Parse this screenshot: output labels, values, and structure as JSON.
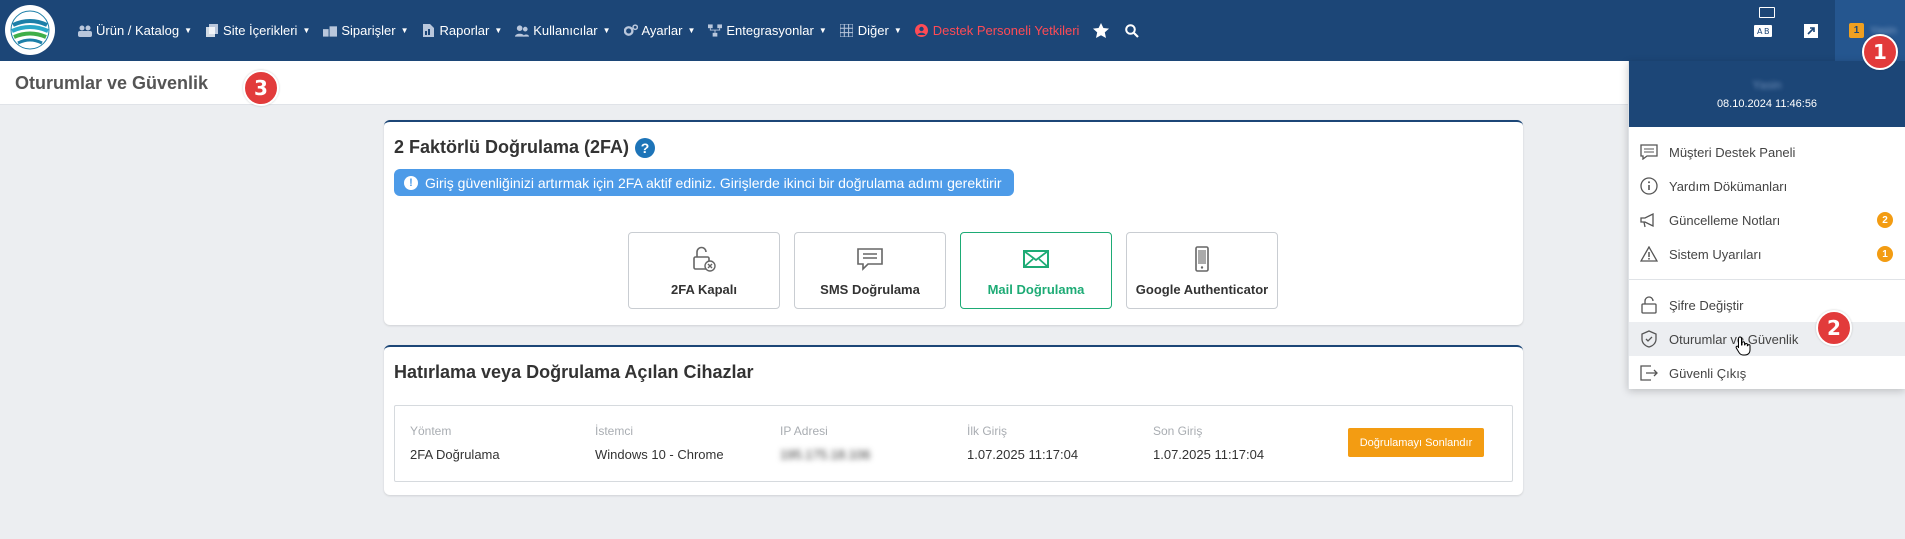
{
  "nav": {
    "items": [
      {
        "label": "Ürün / Katalog",
        "icon": "users-icon"
      },
      {
        "label": "Site İçerikleri",
        "icon": "files-icon"
      },
      {
        "label": "Siparişler",
        "icon": "cart-icon"
      },
      {
        "label": "Raporlar",
        "icon": "report-icon"
      },
      {
        "label": "Kullanıcılar",
        "icon": "user-group-icon"
      },
      {
        "label": "Ayarlar",
        "icon": "gears-icon"
      },
      {
        "label": "Entegrasyonlar",
        "icon": "sitemap-icon"
      },
      {
        "label": "Diğer",
        "icon": "grid-icon"
      }
    ],
    "support": "Destek Personeli Yetkileri",
    "user_badge": "1",
    "user_name": "Yasin"
  },
  "page": {
    "title": "Oturumlar ve Güvenlik"
  },
  "twofa": {
    "title": "2 Faktörlü Doğrulama (2FA)",
    "info": "Giriş güvenliğinizi artırmak için 2FA aktif ediniz. Girişlerde ikinci bir doğrulama adımı gerektirir",
    "options": [
      {
        "label": "2FA Kapalı",
        "icon": "unlock-icon"
      },
      {
        "label": "SMS Doğrulama",
        "icon": "message-icon"
      },
      {
        "label": "Mail Doğrulama",
        "icon": "envelope-icon",
        "active": true
      },
      {
        "label": "Google Authenticator",
        "icon": "phone-icon"
      }
    ]
  },
  "devices": {
    "title": "Hatırlama veya Doğrulama Açılan Cihazlar",
    "columns": [
      "Yöntem",
      "İstemci",
      "IP Adresi",
      "İlk Giriş",
      "Son Giriş"
    ],
    "row": [
      "2FA Doğrulama",
      "Windows 10 - Chrome",
      "195.175.18.106",
      "1.07.2025 11:17:04",
      "1.07.2025 11:17:04"
    ],
    "end_button": "Doğrulamayı Sonlandır"
  },
  "dropdown": {
    "name": "Yasin",
    "datetime": "08.10.2024 11:46:56",
    "items": [
      {
        "label": "Müşteri Destek Paneli",
        "icon": "chat-icon"
      },
      {
        "label": "Yardım Dökümanları",
        "icon": "info-icon"
      },
      {
        "label": "Güncelleme Notları",
        "icon": "megaphone-icon",
        "count": "2"
      },
      {
        "label": "Sistem Uyarıları",
        "icon": "warning-icon",
        "count": "1"
      },
      {
        "label": "Şifre Değiştir",
        "icon": "lock-icon"
      },
      {
        "label": "Oturumlar ve Güvenlik",
        "icon": "shield-icon"
      },
      {
        "label": "Güvenli Çıkış",
        "icon": "logout-icon"
      }
    ]
  },
  "callouts": [
    "1",
    "2",
    "3"
  ],
  "colors": {
    "navbar": "#1c4677",
    "accent_green": "#1dab75",
    "orange": "#f39c12",
    "callout_red": "#e23b3b"
  }
}
